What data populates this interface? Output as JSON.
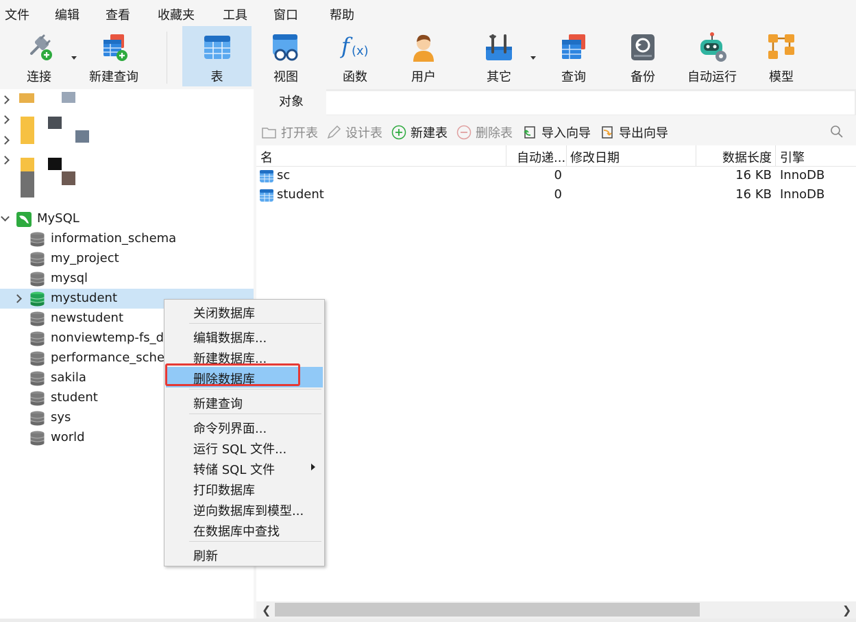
{
  "menubar": [
    "文件",
    "编辑",
    "查看",
    "收藏夹",
    "工具",
    "窗口",
    "帮助"
  ],
  "toolbar": {
    "connect": "连接",
    "new_query": "新建查询",
    "table": "表",
    "view": "视图",
    "function": "函数",
    "user": "用户",
    "other": "其它",
    "query": "查询",
    "backup": "备份",
    "automation": "自动运行",
    "model": "模型"
  },
  "sidebar": {
    "connection": "MySQL",
    "databases": [
      "information_schema",
      "my_project",
      "mysql",
      "mystudent",
      "newstudent",
      "nonviewtemp-fs_da",
      "performance_schem",
      "sakila",
      "student",
      "sys",
      "world"
    ],
    "selected": "mystudent"
  },
  "tabs": {
    "objects": "对象"
  },
  "object_toolbar": {
    "open_table": "打开表",
    "design_table": "设计表",
    "new_table": "新建表",
    "delete_table": "删除表",
    "import_wizard": "导入向导",
    "export_wizard": "导出向导"
  },
  "grid": {
    "headers": [
      "名",
      "自动递...",
      "修改日期",
      "数据长度",
      "引擎"
    ],
    "rows": [
      {
        "name": "sc",
        "auto_inc": "0",
        "modified": "",
        "data_length": "16 KB",
        "engine": "InnoDB"
      },
      {
        "name": "student",
        "auto_inc": "0",
        "modified": "",
        "data_length": "16 KB",
        "engine": "InnoDB"
      }
    ]
  },
  "context_menu": {
    "items": [
      "关闭数据库",
      "编辑数据库...",
      "新建数据库...",
      "删除数据库",
      "新建查询",
      "命令列界面...",
      "运行 SQL 文件...",
      "转储 SQL 文件",
      "打印数据库",
      "逆向数据库到模型...",
      "在数据库中查找",
      "刷新"
    ],
    "highlighted": "删除数据库"
  },
  "colors": {
    "accent": "#91c9f7",
    "highlight_box": "#e53935",
    "active_tool": "#cde3f5",
    "selected_row": "#cce4f7"
  }
}
